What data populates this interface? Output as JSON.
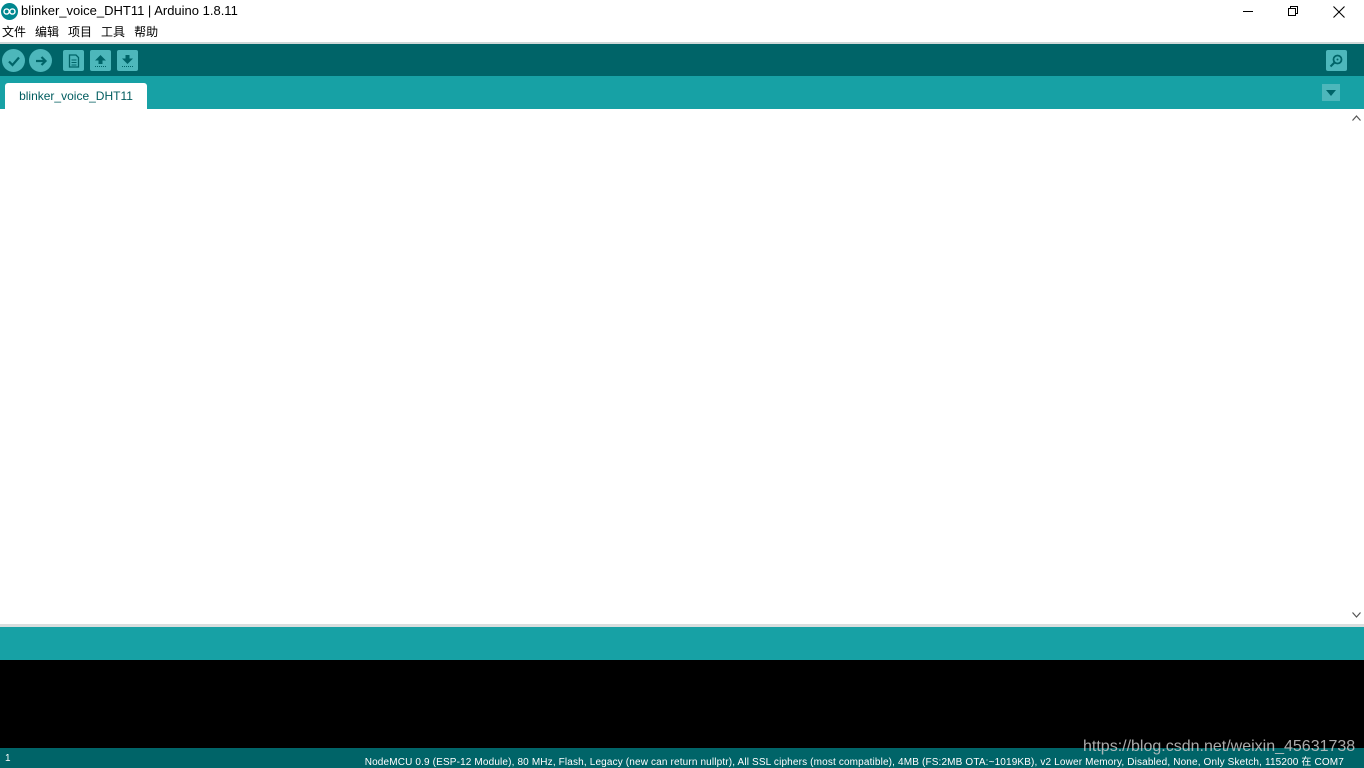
{
  "window": {
    "title": "blinker_voice_DHT11 | Arduino 1.8.11"
  },
  "menu": {
    "items": [
      "文件",
      "编辑",
      "项目",
      "工具",
      "帮助"
    ]
  },
  "toolbar": {
    "buttons": [
      "verify-icon",
      "upload-icon",
      "new-icon",
      "open-icon",
      "save-icon"
    ],
    "right_button": "serial-monitor-icon"
  },
  "tabs": {
    "items": [
      {
        "label": "blinker_voice_DHT11"
      }
    ]
  },
  "status": {
    "line": "1",
    "board": "NodeMCU 0.9 (ESP-12 Module), 80 MHz, Flash, Legacy (new can return nullptr), All SSL ciphers (most compatible), 4MB (FS:2MB OTA:~1019KB), v2 Lower Memory, Disabled, None, Only Sketch, 115200 在 COM7"
  },
  "watermark": "https://blog.csdn.net/weixin_45631738",
  "colors": {
    "toolbar": "#006468",
    "tabstrip": "#17a1a5",
    "button": "#4db7bb",
    "console": "#000000"
  }
}
